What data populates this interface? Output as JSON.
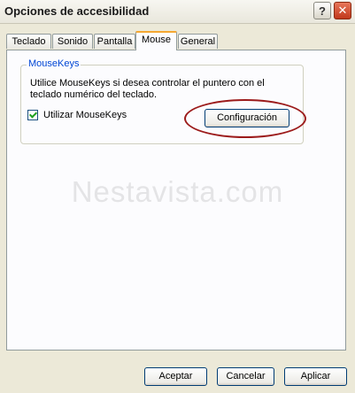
{
  "window": {
    "title": "Opciones de accesibilidad",
    "help_glyph": "?",
    "close_glyph": "✕"
  },
  "tabs": [
    {
      "label": "Teclado"
    },
    {
      "label": "Sonido"
    },
    {
      "label": "Pantalla"
    },
    {
      "label": "Mouse"
    },
    {
      "label": "General"
    }
  ],
  "active_tab": "Mouse",
  "mousekeys": {
    "group_title": "MouseKeys",
    "description": "Utilice MouseKeys si desea controlar el puntero con el teclado numérico del teclado.",
    "checkbox_label": "Utilizar MouseKeys",
    "checkbox_checked": true,
    "config_button": "Configuración"
  },
  "watermark": "Nestavista.com",
  "footer": {
    "accept": "Aceptar",
    "cancel": "Cancelar",
    "apply": "Aplicar"
  },
  "colors": {
    "highlight_ellipse": "#9c1b1b",
    "group_title": "#0046d5",
    "active_tab_accent": "#f5a832"
  }
}
